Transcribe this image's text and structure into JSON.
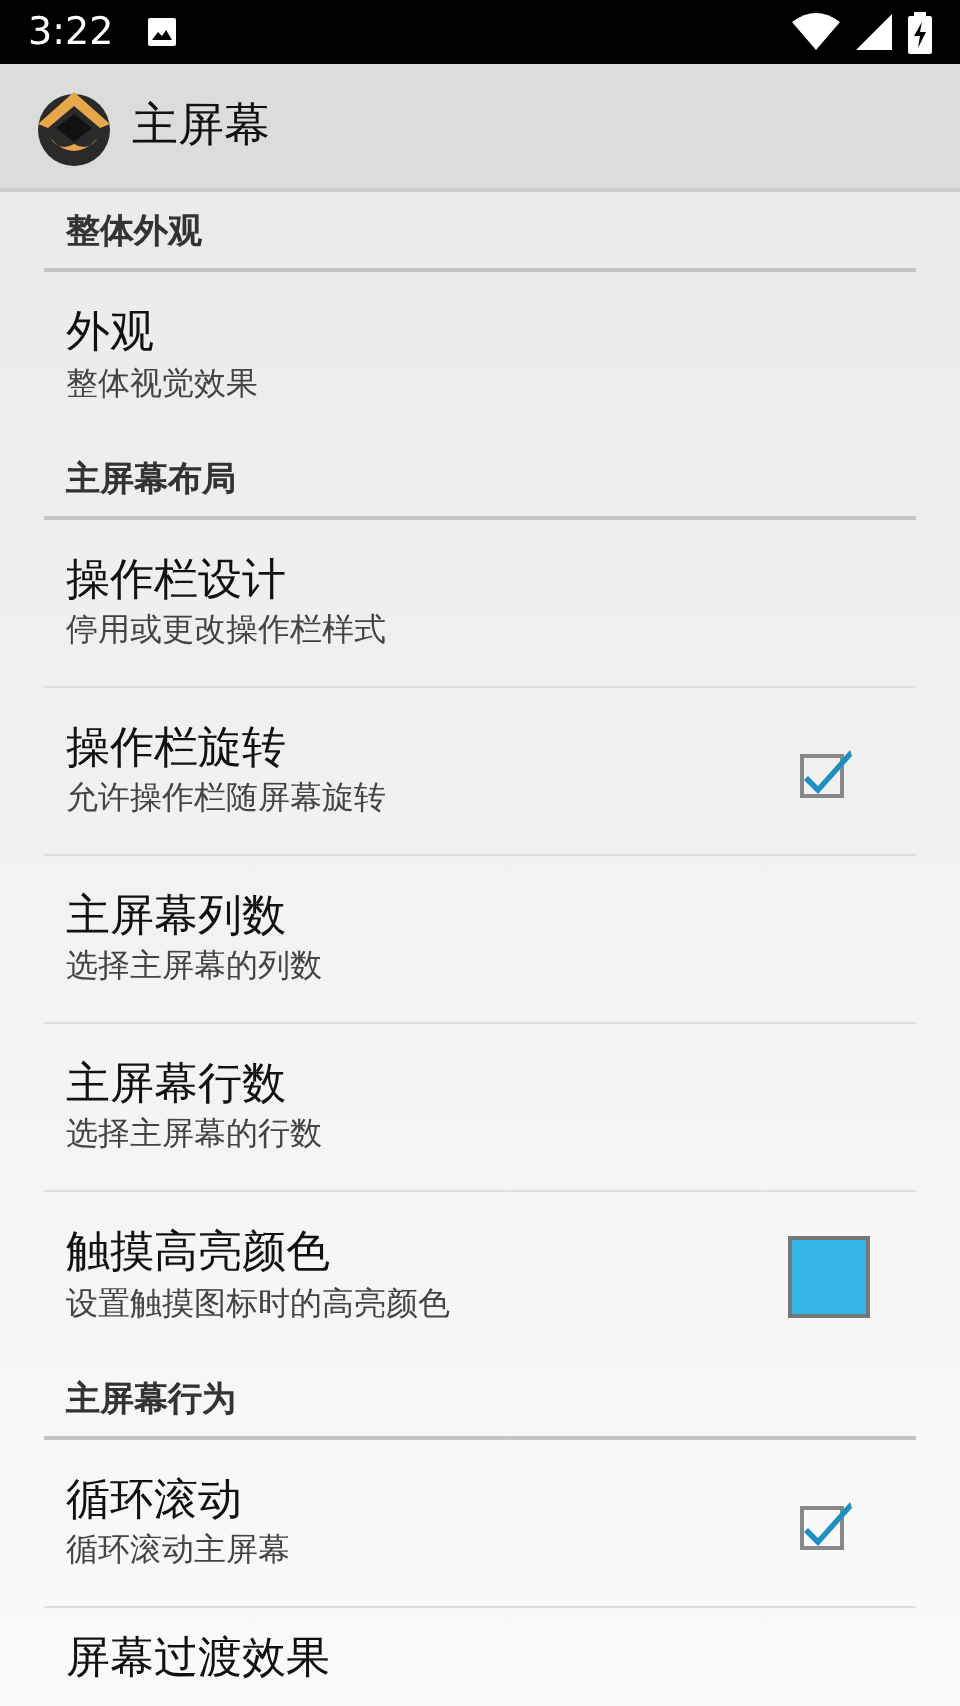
{
  "status_bar": {
    "time": "3:22"
  },
  "app_bar": {
    "title": "主屏幕"
  },
  "sections": [
    {
      "title": "整体外观",
      "items": [
        {
          "kind": "plain",
          "title": "外观",
          "summary": "整体视觉效果"
        }
      ]
    },
    {
      "title": "主屏幕布局",
      "items": [
        {
          "kind": "plain",
          "title": "操作栏设计",
          "summary": "停用或更改操作栏样式"
        },
        {
          "kind": "checkbox",
          "title": "操作栏旋转",
          "summary": "允许操作栏随屏幕旋转",
          "checked": true
        },
        {
          "kind": "plain",
          "title": "主屏幕列数",
          "summary": "选择主屏幕的列数"
        },
        {
          "kind": "plain",
          "title": "主屏幕行数",
          "summary": "选择主屏幕的行数"
        },
        {
          "kind": "color",
          "title": "触摸高亮颜色",
          "summary": "设置触摸图标时的高亮颜色",
          "color": "#33b5e5"
        }
      ]
    },
    {
      "title": "主屏幕行为",
      "items": [
        {
          "kind": "checkbox",
          "title": "循环滚动",
          "summary": "循环滚动主屏幕",
          "checked": true
        },
        {
          "kind": "plain",
          "title": "屏幕过渡效果"
        }
      ]
    }
  ]
}
